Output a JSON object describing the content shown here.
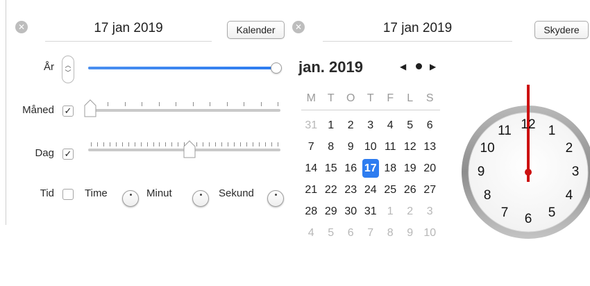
{
  "left_panel": {
    "clear_icon": "x-circle-icon",
    "date_value": "17 jan 2019",
    "mode_button": "Kalender",
    "rows": {
      "year_label": "År",
      "year_slider_value": 1.0,
      "month_label": "Måned",
      "month_checked": true,
      "month_slider_value": 0.0,
      "day_label": "Dag",
      "day_checked": true,
      "day_slider_value": 0.53,
      "time_label": "Tid",
      "time_checked": false,
      "hour_label": "Time",
      "minute_label": "Minut",
      "second_label": "Sekund"
    },
    "accent_color": "#2d7cf0"
  },
  "right_panel": {
    "clear_icon": "x-circle-icon",
    "date_value": "17 jan 2019",
    "mode_button": "Skydere",
    "calendar": {
      "month_title": "jan. 2019",
      "weekdays": [
        "M",
        "T",
        "O",
        "T",
        "F",
        "L",
        "S"
      ],
      "weeks": [
        [
          {
            "d": "31",
            "o": true
          },
          {
            "d": "1"
          },
          {
            "d": "2"
          },
          {
            "d": "3"
          },
          {
            "d": "4"
          },
          {
            "d": "5"
          },
          {
            "d": "6"
          }
        ],
        [
          {
            "d": "7"
          },
          {
            "d": "8"
          },
          {
            "d": "9"
          },
          {
            "d": "10"
          },
          {
            "d": "11"
          },
          {
            "d": "12"
          },
          {
            "d": "13"
          }
        ],
        [
          {
            "d": "14"
          },
          {
            "d": "15"
          },
          {
            "d": "16"
          },
          {
            "d": "17",
            "sel": true
          },
          {
            "d": "18"
          },
          {
            "d": "19"
          },
          {
            "d": "20"
          }
        ],
        [
          {
            "d": "21"
          },
          {
            "d": "22"
          },
          {
            "d": "23"
          },
          {
            "d": "24"
          },
          {
            "d": "25"
          },
          {
            "d": "26"
          },
          {
            "d": "27"
          }
        ],
        [
          {
            "d": "28"
          },
          {
            "d": "29"
          },
          {
            "d": "30"
          },
          {
            "d": "31"
          },
          {
            "d": "1",
            "o": true
          },
          {
            "d": "2",
            "o": true
          },
          {
            "d": "3",
            "o": true
          }
        ],
        [
          {
            "d": "4",
            "o": true
          },
          {
            "d": "5",
            "o": true
          },
          {
            "d": "6",
            "o": true
          },
          {
            "d": "7",
            "o": true
          },
          {
            "d": "8",
            "o": true
          },
          {
            "d": "9",
            "o": true
          },
          {
            "d": "10",
            "o": true
          }
        ]
      ],
      "selected_color": "#2d7cf0"
    },
    "clock": {
      "numbers": [
        "12",
        "1",
        "2",
        "3",
        "4",
        "5",
        "6",
        "7",
        "8",
        "9",
        "10",
        "11"
      ],
      "hand_color": "#cc1111"
    }
  }
}
